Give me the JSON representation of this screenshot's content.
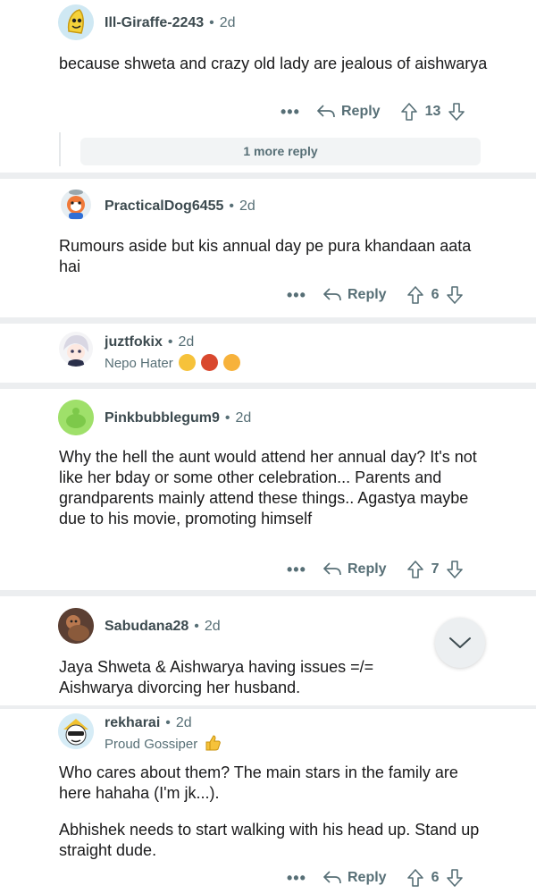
{
  "comments": [
    {
      "username": "Ill-Giraffe-2243",
      "age": "2d",
      "body": [
        "because shweta and crazy old lady are jealous of aishwarya"
      ],
      "more": "•••",
      "reply_label": "Reply",
      "votes": "13",
      "more_replies": "1 more reply"
    },
    {
      "username": "PracticalDog6455",
      "age": "2d",
      "body": [
        "Rumours aside but kis annual day pe pura khandaan aata hai"
      ],
      "more": "•••",
      "reply_label": "Reply",
      "votes": "6"
    },
    {
      "username": "juztfokix",
      "age": "2d",
      "flair": "Nepo Hater"
    },
    {
      "username": "Pinkbubblegum9",
      "age": "2d",
      "body": [
        "Why the hell the aunt would attend her annual day? It's not like her bday or some other celebration... Parents and grandparents mainly attend these things.. Agastya maybe due to his movie, promoting himself"
      ],
      "more": "•••",
      "reply_label": "Reply",
      "votes": "7"
    },
    {
      "username": "Sabudana28",
      "age": "2d",
      "body": [
        "Jaya Shweta & Aishwarya having issues =/= Aishwarya divorcing her husband."
      ]
    },
    {
      "username": "rekharai",
      "age": "2d",
      "flair": "Proud Gossiper",
      "body": [
        "Who cares about them? The main stars in the family are here hahaha (I'm jk...).",
        "Abhishek needs to start walking with his head up. Stand up straight dude."
      ],
      "more": "•••",
      "reply_label": "Reply",
      "votes": "6"
    }
  ],
  "meta_dot": "•",
  "colors": {
    "text": "#1a1a1b",
    "meta": "#576f76",
    "separator": "#eceef0",
    "button_bg": "#eceff1"
  },
  "icons": {
    "reply": "reply-arrow-icon",
    "upvote": "upvote-arrow-icon",
    "downvote": "downvote-arrow-icon",
    "scroll": "chevron-down-icon"
  }
}
